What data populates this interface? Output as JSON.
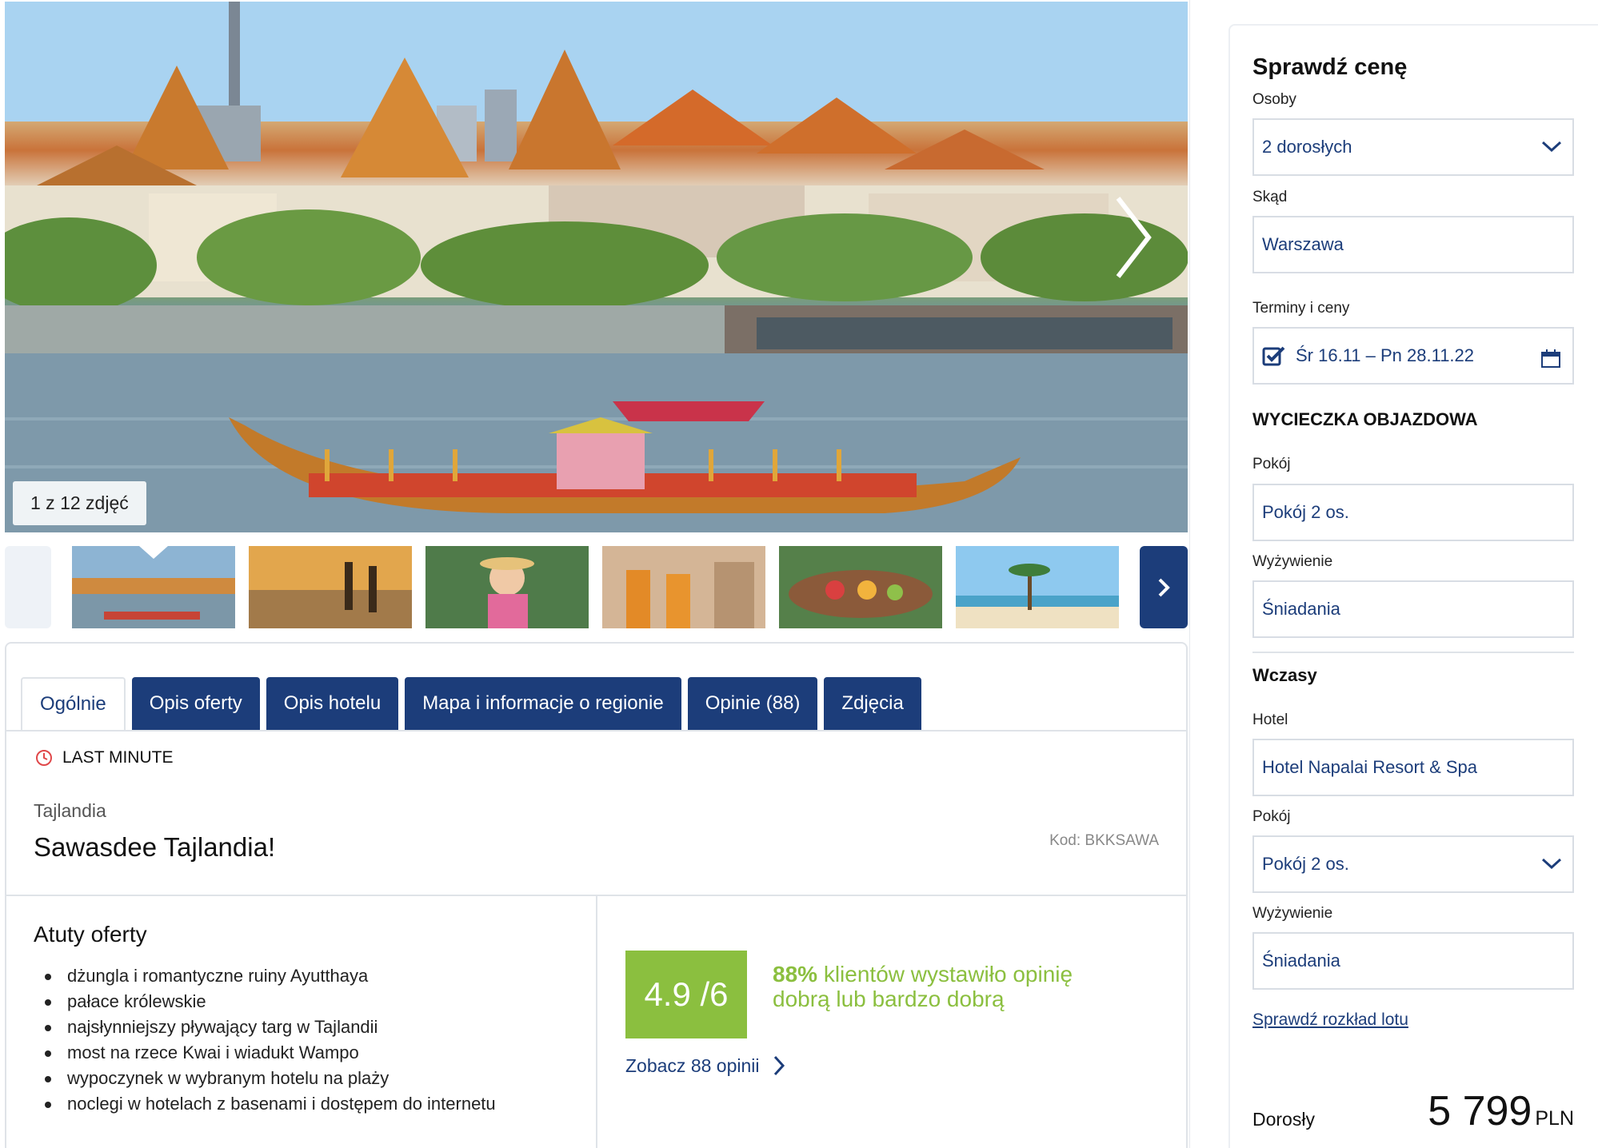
{
  "gallery": {
    "counter": "1 z 12 zdjęć",
    "thumbnails": [
      "grand-palace",
      "monks-sunset",
      "floating-market-girl",
      "temple-monks",
      "floating-market-boat",
      "beach-palms"
    ]
  },
  "tabs": [
    {
      "label": "Ogólnie",
      "active": true
    },
    {
      "label": "Opis oferty",
      "active": false
    },
    {
      "label": "Opis hotelu",
      "active": false
    },
    {
      "label": "Mapa i informacje o regionie",
      "active": false
    },
    {
      "label": "Opinie (88)",
      "active": false
    },
    {
      "label": "Zdjęcia",
      "active": false
    }
  ],
  "offer": {
    "badge": "LAST MINUTE",
    "country": "Tajlandia",
    "title": "Sawasdee Tajlandia!",
    "code": "Kod: BKKSAWA"
  },
  "atuty": {
    "title": "Atuty oferty",
    "items": [
      "dżungla i romantyczne ruiny Ayutthaya",
      "pałace królewskie",
      "najsłynniejszy pływający targ w Tajlandii",
      "most na rzece Kwai i wiadukt Wampo",
      "wypoczynek w wybranym hotelu na plaży",
      "noclegi w hotelach z basenami i dostępem do internetu"
    ]
  },
  "rating": {
    "score": "4.9 /6",
    "percent": "88%",
    "text": " klientów wystawiło opinię dobrą lub bardzo dobrą",
    "link": "Zobacz 88 opinii"
  },
  "sidebar": {
    "title": "Sprawdź cenę",
    "persons_label": "Osoby",
    "persons_value": "2 dorosłych",
    "from_label": "Skąd",
    "from_value": "Warszawa",
    "dates_label": "Terminy i ceny",
    "dates_value": "Śr 16.11 – Pn 28.11.22",
    "tour_heading": "WYCIECZKA OBJAZDOWA",
    "tour_room_label": "Pokój",
    "tour_room_value": "Pokój 2 os.",
    "tour_board_label": "Wyżywienie",
    "tour_board_value": "Śniadania",
    "stay_heading": "Wczasy",
    "hotel_label": "Hotel",
    "hotel_value": "Hotel Napalai Resort & Spa",
    "stay_room_label": "Pokój",
    "stay_room_value": "Pokój 2 os.",
    "stay_board_label": "Wyżywienie",
    "stay_board_value": "Śniadania",
    "flight_link": "Sprawdź rozkład lotu",
    "price_label": "Dorosły",
    "price_value": "5 799",
    "price_currency": "PLN"
  },
  "colors": {
    "brand": "#1c3d7a",
    "rating": "#8bbf3f",
    "badge_icon": "#e0484a"
  }
}
